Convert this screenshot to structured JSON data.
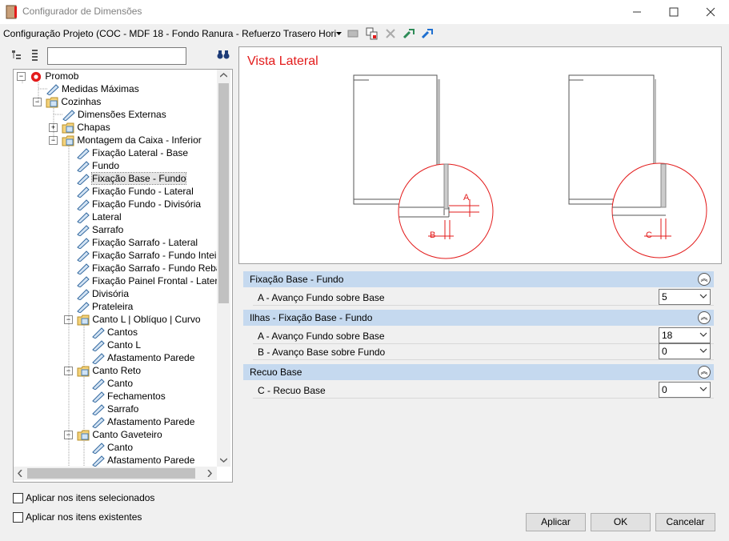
{
  "window": {
    "title": "Configurador de Dimensões"
  },
  "config_bar": {
    "value": "Configuração Projeto (COC - MDF 18 - Fondo Ranura - Refuerzo Trasero Hori"
  },
  "tree": {
    "items": [
      {
        "label": "Promob"
      },
      {
        "label": "Medidas Máximas"
      },
      {
        "label": "Cozinhas"
      },
      {
        "label": "Dimensões Externas"
      },
      {
        "label": "Chapas"
      },
      {
        "label": "Montagem da Caixa - Inferior"
      },
      {
        "label": "Fixação Lateral - Base"
      },
      {
        "label": "Fundo"
      },
      {
        "label": "Fixação Base - Fundo"
      },
      {
        "label": "Fixação Fundo - Lateral"
      },
      {
        "label": "Fixação Fundo - Divisória"
      },
      {
        "label": "Lateral"
      },
      {
        "label": "Sarrafo"
      },
      {
        "label": "Fixação Sarrafo - Lateral"
      },
      {
        "label": "Fixação Sarrafo - Fundo Inteiro"
      },
      {
        "label": "Fixação Sarrafo - Fundo Rebaixa"
      },
      {
        "label": "Fixação Painel Frontal - Lateral"
      },
      {
        "label": "Divisória"
      },
      {
        "label": "Prateleira"
      },
      {
        "label": "Canto L | Oblíquo | Curvo"
      },
      {
        "label": "Cantos"
      },
      {
        "label": "Canto L"
      },
      {
        "label": "Afastamento Parede"
      },
      {
        "label": "Canto Reto"
      },
      {
        "label": "Canto"
      },
      {
        "label": "Fechamentos"
      },
      {
        "label": "Sarrafo"
      },
      {
        "label": "Afastamento Parede"
      },
      {
        "label": "Canto Gaveteiro"
      },
      {
        "label": "Canto"
      },
      {
        "label": "Afastamento Parede"
      }
    ]
  },
  "preview": {
    "title": "Vista Lateral",
    "labels": {
      "a": "A",
      "b": "B",
      "c": "C"
    },
    "accent_color": "#e31b1b"
  },
  "sections": [
    {
      "title": "Fixação Base - Fundo",
      "rows": [
        {
          "label": "A - Avanço Fundo sobre Base",
          "value": "5"
        }
      ]
    },
    {
      "title": "Ilhas - Fixação Base - Fundo",
      "rows": [
        {
          "label": "A - Avanço Fundo sobre Base",
          "value": "18"
        },
        {
          "label": "B - Avanço Base sobre Fundo",
          "value": "0"
        }
      ]
    },
    {
      "title": "Recuo Base",
      "rows": [
        {
          "label": "C - Recuo Base",
          "value": "0"
        }
      ]
    }
  ],
  "options": {
    "apply_selected": "Aplicar nos itens selecionados",
    "apply_existing": "Aplicar nos itens existentes"
  },
  "buttons": {
    "apply": "Aplicar",
    "ok": "OK",
    "cancel": "Cancelar"
  }
}
